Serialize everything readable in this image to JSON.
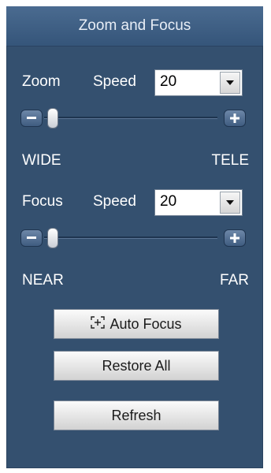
{
  "header": {
    "title": "Zoom and Focus"
  },
  "zoom": {
    "label": "Zoom",
    "speed_label": "Speed",
    "speed_value": "20",
    "slider_level": 0.05,
    "min_label": "WIDE",
    "max_label": "TELE"
  },
  "focus": {
    "label": "Focus",
    "speed_label": "Speed",
    "speed_value": "20",
    "slider_level": 0.05,
    "min_label": "NEAR",
    "max_label": "FAR"
  },
  "buttons": {
    "auto_focus": "Auto Focus",
    "restore_all": "Restore All",
    "refresh": "Refresh"
  },
  "colors": {
    "panel_bg": "#34506f",
    "header_bg": "#4a6b90"
  }
}
